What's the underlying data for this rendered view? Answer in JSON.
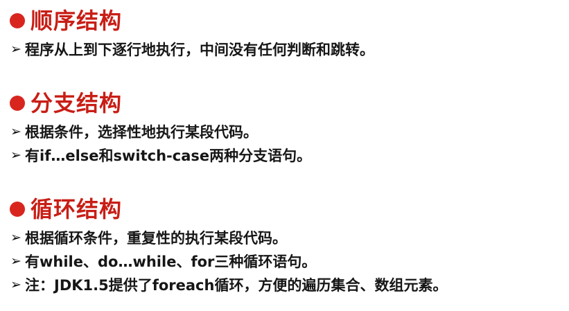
{
  "sections": [
    {
      "title": "顺序结构",
      "items": [
        "程序从上到下逐行地执行，中间没有任何判断和跳转。"
      ]
    },
    {
      "title": "分支结构",
      "items": [
        "根据条件，选择性地执行某段代码。",
        "有if…else和switch-case两种分支语句。"
      ]
    },
    {
      "title": "循环结构",
      "items": [
        "根据循环条件，重复性的执行某段代码。",
        "有while、do…while、for三种循环语句。",
        "注：JDK1.5提供了foreach循环，方便的遍历集合、数组元素。"
      ]
    }
  ],
  "colors": {
    "heading": "#c81e16",
    "bullet": "#d8261f",
    "text": "#161616"
  },
  "icons": {
    "section_bullet": "red-dot-icon",
    "item_marker": "arrowhead-icon"
  }
}
